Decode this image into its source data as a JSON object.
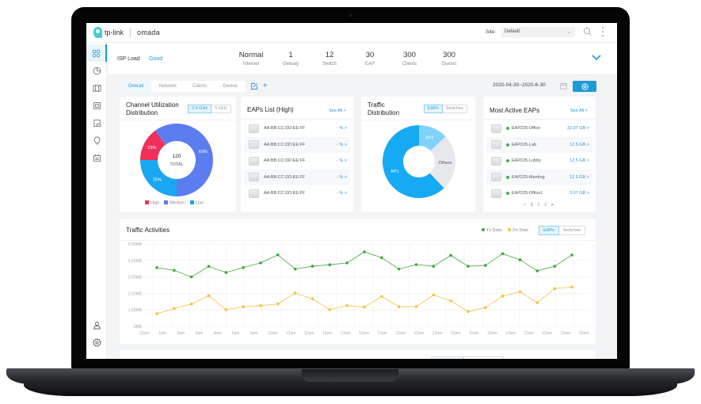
{
  "topbar": {
    "brand": "tp-link",
    "product": "omada",
    "site_label": "Site:",
    "site_value": "Default"
  },
  "sidebar": {
    "items": [
      {
        "name": "dashboard",
        "icon": "grid-icon",
        "active": true
      },
      {
        "name": "statistics",
        "icon": "pie-chart-icon"
      },
      {
        "name": "map",
        "icon": "map-icon"
      },
      {
        "name": "devices",
        "icon": "device-icon"
      },
      {
        "name": "clients",
        "icon": "monitor-icon"
      },
      {
        "name": "insights",
        "icon": "lightbulb-icon"
      },
      {
        "name": "logs",
        "icon": "log-icon"
      }
    ],
    "bottom_items": [
      {
        "name": "account",
        "icon": "user-icon"
      },
      {
        "name": "settings",
        "icon": "gear-icon"
      }
    ]
  },
  "isp": {
    "label": "ISP Load",
    "status": "Good",
    "stats": [
      {
        "value": "Normal",
        "label": "Internet"
      },
      {
        "value": "1",
        "label": "Getway"
      },
      {
        "value": "12",
        "label": "Switch"
      },
      {
        "value": "30",
        "label": "EAP"
      },
      {
        "value": "300",
        "label": "Clients"
      },
      {
        "value": "300",
        "label": "Guests"
      }
    ]
  },
  "tabs": {
    "items": [
      "Overall",
      "Network",
      "Clients",
      "Device"
    ],
    "active": "Overall",
    "date_range": "2020-04-30~2020-6-30"
  },
  "channel_util": {
    "title_line1": "Channel Utilization",
    "title_line2": "Distribution",
    "bands": [
      "2.4 GHz",
      "5 GHz"
    ],
    "active_band": "2.4 GHz",
    "center_value": "120",
    "center_label": "TOTAL",
    "legend": [
      "High",
      "Medium",
      "Low"
    ]
  },
  "eaps_high": {
    "title": "EAPs List (High)",
    "see_all": "See All >",
    "rows": [
      {
        "mac": "AA:BB:CC:DD:EE:FF",
        "value": "- % >"
      },
      {
        "mac": "AA:BB:CC:DD:EE:FF",
        "value": "- % >"
      },
      {
        "mac": "AA:BB:CC:DD:EE:FF",
        "value": "- % >"
      },
      {
        "mac": "AA:BB:CC:DD:EE:FF",
        "value": "- % >"
      },
      {
        "mac": "AA:BB:CC:DD:EE:FF",
        "value": "- % >"
      }
    ]
  },
  "traffic_dist": {
    "title_line1": "Traffic",
    "title_line2": "Distribution",
    "toggle": [
      "EAPs",
      "Switches"
    ],
    "active": "EAPs"
  },
  "most_active": {
    "title": "Most Active EAPs",
    "see_all": "See All >",
    "rows": [
      {
        "name": "EAP225-Office",
        "value": "32.07 GB >"
      },
      {
        "name": "EAP225-Lab",
        "value": "12.5 GB >"
      },
      {
        "name": "EAP225-Lobby",
        "value": "12.5 GB >"
      },
      {
        "name": "EAP225-Meeting",
        "value": "12.5 GB >"
      },
      {
        "name": "EAP225-Office1",
        "value": "3.07 GB >"
      }
    ],
    "pager": {
      "prev": "<",
      "pages": [
        "1",
        "2",
        "3"
      ],
      "current": "1",
      "next": ">"
    }
  },
  "traffic_activities": {
    "title": "Traffic Activities",
    "legend": [
      "Tx Data",
      "Dx Date"
    ],
    "toggle": [
      "EAPs",
      "Switches"
    ],
    "active": "EAPs"
  },
  "colors": {
    "accent": "#1d9ad6",
    "high": "#f0305a",
    "medium": "#5b7df0",
    "low": "#1aa6f0",
    "tx": "#3aaa3a",
    "dx": "#f5c243",
    "ap1": "#16a9f4",
    "ap2": "#7fd2fa",
    "others": "#e6e8eb"
  },
  "chart_data": [
    {
      "type": "pie",
      "title": "Channel Utilization Distribution",
      "labels": [
        "High",
        "Medium",
        "Low"
      ],
      "values": [
        15,
        60,
        25
      ],
      "value_labels": [
        "15%",
        "60%",
        "25%"
      ],
      "center_text": "120 TOTAL",
      "legend": "bottom"
    },
    {
      "type": "pie",
      "title": "Traffic Distribution",
      "labels": [
        "AP1",
        "AP2",
        "Others"
      ],
      "values": [
        62,
        13,
        25
      ]
    },
    {
      "type": "line",
      "title": "Traffic Activities",
      "x": [
        "12am",
        "1am",
        "2am",
        "3am",
        "4am",
        "5am",
        "6am",
        "12am",
        "12am",
        "12am",
        "12am",
        "12am",
        "12am",
        "12am",
        "12am",
        "12am",
        "12am",
        "12am",
        "12am",
        "12am",
        "12am",
        "12am",
        "12am",
        "12am",
        "12am"
      ],
      "series": [
        {
          "name": "Tx Data",
          "values": [
            3.57,
            3.4,
            3.0,
            3.64,
            3.27,
            3.57,
            3.85,
            4.34,
            3.48,
            3.65,
            3.74,
            3.85,
            4.52,
            4.17,
            3.48,
            3.75,
            3.65,
            4.31,
            3.65,
            3.7,
            4.41,
            4.04,
            3.37,
            3.65,
            4.33
          ]
        },
        {
          "name": "Dx Date",
          "values": [
            0.77,
            1.09,
            1.36,
            1.86,
            1.01,
            1.19,
            1.26,
            1.36,
            2.02,
            1.67,
            1.01,
            1.26,
            1.17,
            1.81,
            1.19,
            1.2,
            1.91,
            1.55,
            0.9,
            1.14,
            1.84,
            2.1,
            1.44,
            2.29,
            2.39
          ]
        }
      ],
      "yticks": [
        "0MB",
        "1.00MB",
        "2.00MB",
        "3.00MB",
        "4.00MB",
        "5.00MB"
      ],
      "ylim": [
        0,
        5
      ],
      "ylabel": "",
      "xlabel": "",
      "grid": true,
      "legend": "top-right"
    }
  ]
}
